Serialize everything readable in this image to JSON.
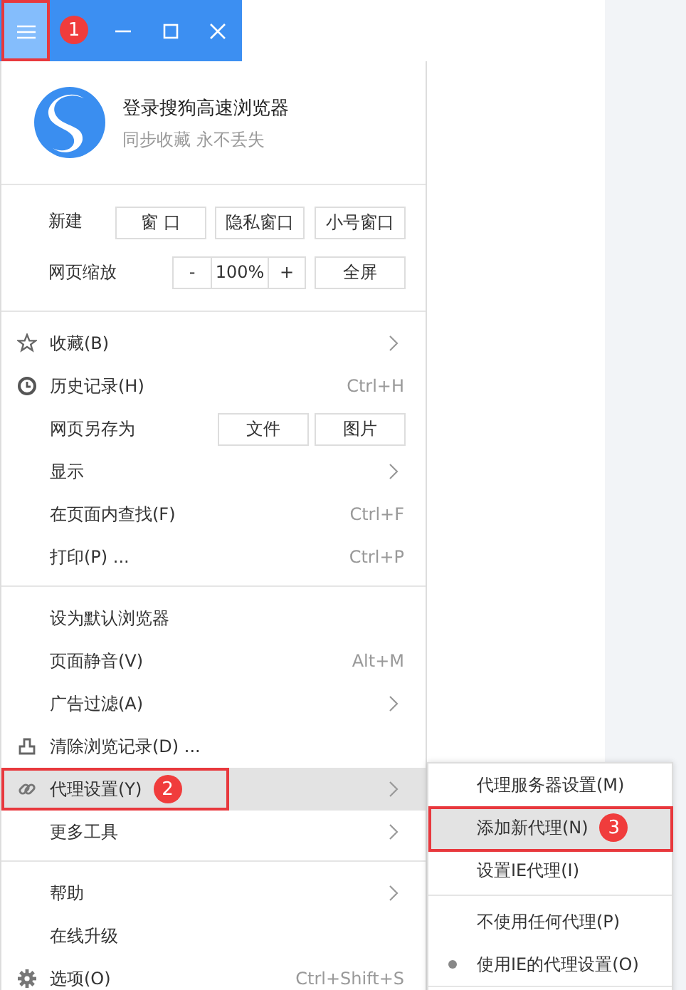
{
  "titlebar": {
    "menu_button": {
      "annotated": true,
      "badge": "1"
    },
    "controls": [
      {
        "kind": "minimize"
      },
      {
        "kind": "maximize"
      },
      {
        "kind": "close"
      }
    ]
  },
  "account": {
    "title": "登录搜狗高速浏览器",
    "subtitle": "同步收藏 永不丢失"
  },
  "new_window_row": {
    "label": "新建",
    "buttons": [
      "窗 口",
      "隐私窗口",
      "小号窗口"
    ]
  },
  "zoom_row": {
    "label": "网页缩放",
    "minus": "-",
    "value": "100%",
    "plus": "+",
    "fullscreen": "全屏"
  },
  "menu_sections": [
    [
      {
        "label": "收藏(B)",
        "kind": "star",
        "submenu": true,
        "highlighted": false
      },
      {
        "label": "历史记录(H)",
        "kind": "clock",
        "shortcut": "Ctrl+H",
        "highlighted": false
      },
      {
        "label": "网页另存为",
        "buttons": [
          "文件",
          "图片"
        ],
        "highlighted": false
      },
      {
        "label": "显示",
        "submenu": true,
        "highlighted": false
      },
      {
        "label": "在页面内查找(F)",
        "shortcut": "Ctrl+F",
        "highlighted": false
      },
      {
        "label": "打印(P) ...",
        "shortcut": "Ctrl+P",
        "highlighted": false
      }
    ],
    [
      {
        "label": "设为默认浏览器",
        "highlighted": false
      },
      {
        "label": "页面静音(V)",
        "shortcut": "Alt+M",
        "highlighted": false
      },
      {
        "label": "广告过滤(A)",
        "submenu": true,
        "highlighted": false
      },
      {
        "label": "清除浏览记录(D) ...",
        "kind": "eraser",
        "highlighted": false
      },
      {
        "label": "代理设置(Y)",
        "kind": "link",
        "submenu": true,
        "highlighted": true,
        "annotated": true,
        "badge": "2"
      },
      {
        "label": "更多工具",
        "submenu": true,
        "highlighted": false
      }
    ],
    [
      {
        "label": "帮助",
        "submenu": true,
        "highlighted": false
      },
      {
        "label": "在线升级",
        "highlighted": false
      },
      {
        "label": "选项(O)",
        "kind": "gear",
        "shortcut": "Ctrl+Shift+S",
        "highlighted": false
      }
    ]
  ],
  "submenu_sections": [
    [
      {
        "label": "代理服务器设置(M)",
        "highlighted": false
      },
      {
        "label": "添加新代理(N)",
        "highlighted": true,
        "annotated": true,
        "badge": "3"
      },
      {
        "label": "设置IE代理(I)",
        "highlighted": false
      }
    ],
    [
      {
        "label": "不使用任何代理(P)",
        "kind": "radio",
        "selected": false,
        "highlighted": false
      },
      {
        "label": "使用IE的代理设置(O)",
        "kind": "radio",
        "selected": true,
        "highlighted": false
      }
    ]
  ]
}
